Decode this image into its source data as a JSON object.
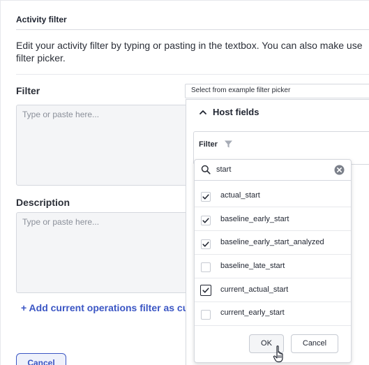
{
  "dialog": {
    "title": "Activity filter",
    "description": "Edit your activity filter by typing or pasting in the textbox. You can also make use filter picker.",
    "filter_label": "Filter",
    "filter_placeholder": "Type or paste here...",
    "description_label": "Description",
    "description_placeholder": "Type or paste here...",
    "add_link": "+ Add current operations filter as cus",
    "cancel_label": "Cancel",
    "example_picker": "Select from example filter picker"
  },
  "picker": {
    "section_title": "Host fields",
    "filter_label": "Filter",
    "search": {
      "value": "start"
    },
    "options": [
      {
        "label": "actual_start",
        "checked": true
      },
      {
        "label": "baseline_early_start",
        "checked": true
      },
      {
        "label": "baseline_early_start_analyzed",
        "checked": true
      },
      {
        "label": "baseline_late_start",
        "checked": false
      },
      {
        "label": "current_actual_start",
        "checked": true
      },
      {
        "label": "current_early_start",
        "checked": false
      }
    ],
    "ok_label": "OK",
    "cancel_label": "Cancel"
  },
  "colors": {
    "accent": "#3b56c4",
    "checkmark": "#1f2430",
    "input_bg": "#f4f5f7"
  },
  "icons": [
    "chevron-up-icon",
    "funnel-icon",
    "search-icon",
    "clear-icon",
    "checkmark-icon",
    "hand-cursor-icon"
  ]
}
